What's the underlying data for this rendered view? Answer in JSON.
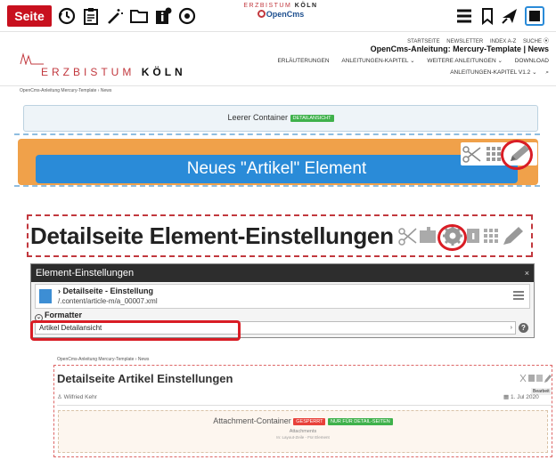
{
  "toolbar": {
    "seite_label": "Seite",
    "logo_top_light": "ERZBISTUM",
    "logo_top_bold": "KÖLN",
    "logo_bottom": "OpenCms",
    "icons": [
      "history-icon",
      "clipboard-icon",
      "magic-wand-icon",
      "folder-icon",
      "info-icon",
      "target-icon",
      "menu-icon",
      "bookmark-icon",
      "publish-icon",
      "selection-icon"
    ]
  },
  "header": {
    "logo_light": "ERZBISTUM",
    "logo_bold": "KÖLN",
    "meta_nav": [
      "STARTSEITE",
      "NEWSLETTER",
      "INDEX A-Z",
      "SUCHE"
    ],
    "site_title": "OpenCms-Anleitung: Mercury-Template | News",
    "main_nav": [
      "ERLÄUTERUNGEN",
      "ANLEITUNGEN-KAPITEL ⌄",
      "WEITERE ANLEITUNGEN ⌄",
      "DOWNLOAD"
    ],
    "sub_nav": "ANLEITUNGEN-KAPITEL V1.2 ⌄"
  },
  "page1": {
    "breadcrumb": "OpenCms-Anleitung Mercury-Template  ›  News",
    "empty_container_label": "Leerer Container",
    "empty_container_badge": "DETAILANSICHT",
    "element_label": "Neues \"Artikel\" Element"
  },
  "page2": {
    "title": "Detailseite Element-Einstellungen"
  },
  "dialog": {
    "title": "Element-Einstellungen",
    "close": "×",
    "file_name": "› Detailseite - Einstellung",
    "file_path": "/.content/article-m/a_00007.xml",
    "formatter_legend": "Formatter",
    "formatter_value": "Artikel Detailansicht",
    "help": "?"
  },
  "page3": {
    "breadcrumb": "OpenCms-Anleitung Mercury-Template  ›  News",
    "title": "Detailseite Artikel Einstellungen",
    "author": "Wilfried Kehr",
    "date": "1. Jul 2020",
    "tooltip": "Bearbeit",
    "attach_title": "Attachment-Container",
    "badge_locked": "GESPERRT",
    "badge_detail": "NUR FÜR DETAIL-SEITEN",
    "attach_sub": "Attachments",
    "attach_sub2": "In: Layout-Zeile - Für Element"
  },
  "colors": {
    "brand_red": "#c8101e",
    "highlight_red": "#d91d25",
    "orange": "#f0a14a",
    "blue": "#2a8bd8"
  }
}
